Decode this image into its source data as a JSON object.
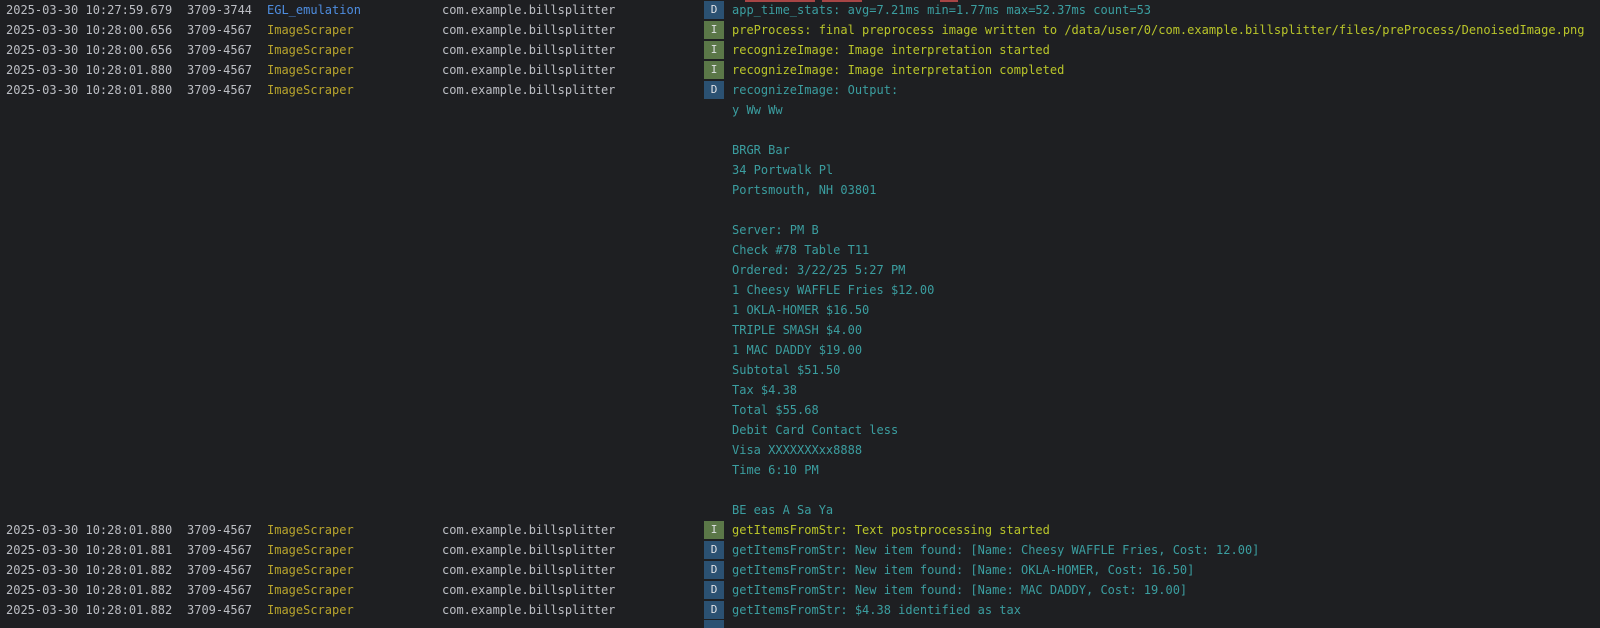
{
  "rows": [
    {
      "ts": "2025-03-30 10:27:59.679",
      "pid": "3709-3744",
      "tag": "EGL_emulation",
      "pkg": "com.example.billsplitter",
      "lvl": "D",
      "msg": "app_time_stats: avg=7.21ms min=1.77ms max=52.37ms count=53"
    },
    {
      "ts": "2025-03-30 10:28:00.656",
      "pid": "3709-4567",
      "tag": "ImageScraper",
      "pkg": "com.example.billsplitter",
      "lvl": "I",
      "msg": "preProcess: final preprocess image written to /data/user/0/com.example.billsplitter/files/preProcess/DenoisedImage.png"
    },
    {
      "ts": "2025-03-30 10:28:00.656",
      "pid": "3709-4567",
      "tag": "ImageScraper",
      "pkg": "com.example.billsplitter",
      "lvl": "I",
      "msg": "recognizeImage: Image interpretation started"
    },
    {
      "ts": "2025-03-30 10:28:01.880",
      "pid": "3709-4567",
      "tag": "ImageScraper",
      "pkg": "com.example.billsplitter",
      "lvl": "I",
      "msg": "recognizeImage: Image interpretation completed"
    },
    {
      "ts": "2025-03-30 10:28:01.880",
      "pid": "3709-4567",
      "tag": "ImageScraper",
      "pkg": "com.example.billsplitter",
      "lvl": "D",
      "msg": "recognizeImage: Output:"
    }
  ],
  "output_lines": [
    "y Ww Ww",
    "",
    "BRGR Bar",
    "34 Portwalk Pl",
    "Portsmouth, NH 03801",
    "",
    "Server: PM B",
    "Check #78 Table T11",
    "Ordered: 3/22/25 5:27 PM",
    "1 Cheesy WAFFLE Fries $12.00",
    "1 OKLA-HOMER $16.50",
    "TRIPLE SMASH $4.00",
    "1 MAC DADDY $19.00",
    "Subtotal $51.50",
    "Tax $4.38",
    "Total $55.68",
    "Debit Card Contact less",
    "Visa XXXXXXXxx8888",
    "Time 6:10 PM",
    "",
    "BE eas A Sa Ya"
  ],
  "rows_after": [
    {
      "ts": "2025-03-30 10:28:01.880",
      "pid": "3709-4567",
      "tag": "ImageScraper",
      "pkg": "com.example.billsplitter",
      "lvl": "I",
      "msg": "getItemsFromStr: Text postprocessing started"
    },
    {
      "ts": "2025-03-30 10:28:01.881",
      "pid": "3709-4567",
      "tag": "ImageScraper",
      "pkg": "com.example.billsplitter",
      "lvl": "D",
      "msg": "getItemsFromStr: New item found: [Name: Cheesy WAFFLE Fries, Cost: 12.00]"
    },
    {
      "ts": "2025-03-30 10:28:01.882",
      "pid": "3709-4567",
      "tag": "ImageScraper",
      "pkg": "com.example.billsplitter",
      "lvl": "D",
      "msg": "getItemsFromStr: New item found: [Name: OKLA-HOMER, Cost: 16.50]"
    },
    {
      "ts": "2025-03-30 10:28:01.882",
      "pid": "3709-4567",
      "tag": "ImageScraper",
      "pkg": "com.example.billsplitter",
      "lvl": "D",
      "msg": "getItemsFromStr: New item found: [Name: MAC DADDY, Cost: 19.00]"
    },
    {
      "ts": "2025-03-30 10:28:01.882",
      "pid": "3709-4567",
      "tag": "ImageScraper",
      "pkg": "com.example.billsplitter",
      "lvl": "D",
      "msg": "getItemsFromStr: $4.38 identified as tax"
    }
  ],
  "colors": {
    "background": "#1e1f22",
    "level_debug_badge": "#2b5172",
    "level_info_badge": "#5b7748",
    "tag_egl": "#4e8de0",
    "tag_imagescraper": "#b8a42c",
    "message_debug": "#3b9ea0",
    "message_info": "#b9c52a",
    "meta_text": "#bcbec4"
  }
}
